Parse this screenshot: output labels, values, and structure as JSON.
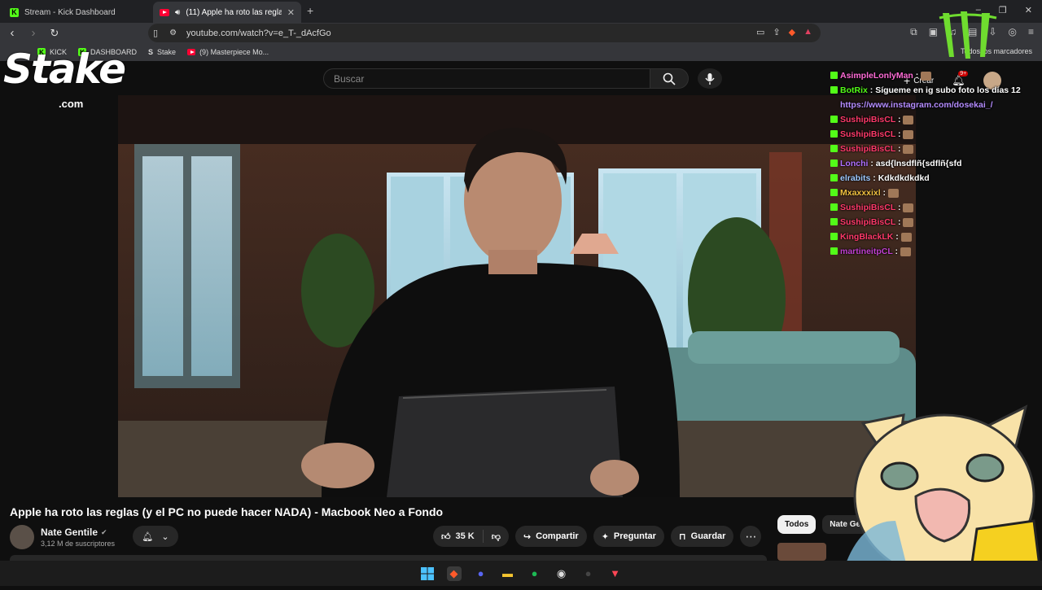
{
  "browser": {
    "tabs": [
      {
        "label": "Stream - Kick Dashboard"
      },
      {
        "label": "(11) Apple ha roto las reglas (",
        "close": "✕"
      }
    ],
    "new_tab": "+",
    "url": "youtube.com/watch?v=e_T-_dAcfGo",
    "bookmarks": [
      {
        "label": "KICK"
      },
      {
        "label": "DASHBOARD"
      },
      {
        "label": "Stake"
      },
      {
        "label": "(9) Masterpiece Mo..."
      }
    ],
    "bookmarks_right": "Todos los marcadores"
  },
  "overlay": {
    "stake_logo": "Stake",
    "stake_com": ".com"
  },
  "youtube": {
    "search_placeholder": "Buscar",
    "create_label": "Crear",
    "notification_count": "9+",
    "video_title": "Apple ha roto las reglas (y el PC no puede hacer NADA) - Macbook Neo a Fondo",
    "channel_name": "Nate Gentile",
    "subscribers": "3,12 M de suscriptores",
    "likes": "35 K",
    "share_label": "Compartir",
    "ask_label": "Preguntar",
    "save_label": "Guardar",
    "chips": [
      "Todos",
      "Nate Ge"
    ]
  },
  "chat": [
    {
      "name": "AsimpleLonlyMan",
      "color": "#ff6bd6",
      "msg": ""
    },
    {
      "name": "BotRix",
      "color": "#53fc18",
      "msg": "Sígueme en ig subo foto los días 12",
      "link": "https://www.instagram.com/dosekai_/"
    },
    {
      "name": "SushipiBisCL",
      "color": "#ff3a6a",
      "msg": ""
    },
    {
      "name": "SushipiBisCL",
      "color": "#ff3a6a",
      "msg": ""
    },
    {
      "name": "SushipiBisCL",
      "color": "#ff3a6a",
      "msg": ""
    },
    {
      "name": "Lonchi",
      "color": "#b070ff",
      "msg": "asd{lnsdflñ{sdflñ{sfd"
    },
    {
      "name": "elrabits",
      "color": "#9ec9ff",
      "msg": "Kdkdkdkdkd"
    },
    {
      "name": "Mxaxxxixl",
      "color": "#f0c040",
      "msg": ""
    },
    {
      "name": "SushipiBisCL",
      "color": "#ff3a6a",
      "msg": ""
    },
    {
      "name": "SushipiBisCL",
      "color": "#ff3a6a",
      "msg": ""
    },
    {
      "name": "KingBlackLK",
      "color": "#ff3a6a",
      "msg": ""
    },
    {
      "name": "martineitpCL",
      "color": "#c040d0",
      "msg": ""
    }
  ],
  "colors": {
    "kick_green": "#53fc18",
    "youtube_red": "#ff0033"
  }
}
